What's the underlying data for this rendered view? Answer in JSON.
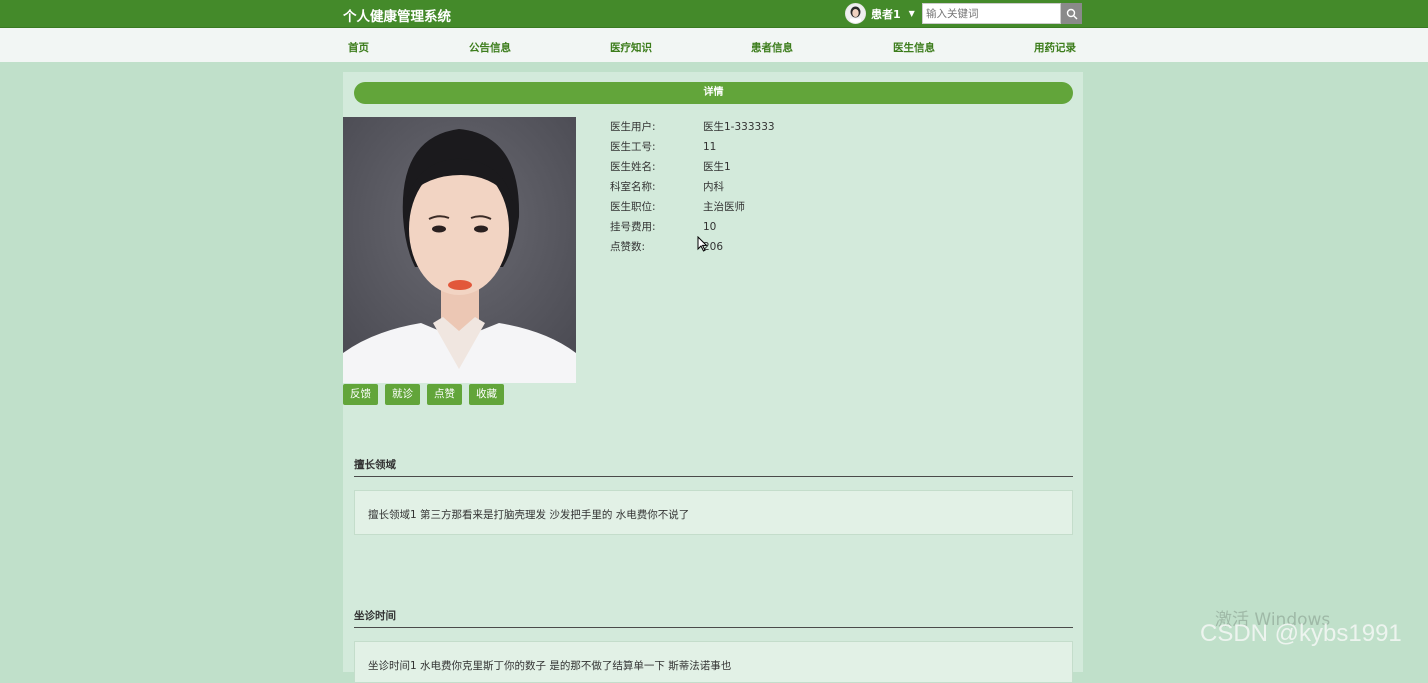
{
  "header": {
    "site_title": "个人健康管理系统",
    "user_name": "患者1",
    "search_placeholder": "输入关键词",
    "search_icon": "search-icon"
  },
  "nav": [
    {
      "label": "首页"
    },
    {
      "label": "公告信息"
    },
    {
      "label": "医疗知识"
    },
    {
      "label": "患者信息"
    },
    {
      "label": "医生信息"
    },
    {
      "label": "用药记录"
    }
  ],
  "detail": {
    "bar_label": "详情",
    "buttons": [
      "反馈",
      "就诊",
      "点赞",
      "收藏"
    ],
    "fields": [
      {
        "label": "医生用户:",
        "value": "医生1-333333"
      },
      {
        "label": "医生工号:",
        "value": "11"
      },
      {
        "label": "医生姓名:",
        "value": "医生1"
      },
      {
        "label": "科室名称:",
        "value": "内科"
      },
      {
        "label": "医生职位:",
        "value": "主治医师"
      },
      {
        "label": "挂号费用:",
        "value": "10"
      },
      {
        "label": "点赞数:",
        "value": "206"
      }
    ]
  },
  "sections": [
    {
      "title": "擅长领域",
      "text": "擅长领域1 第三方那看来是打脑壳理发 沙发把手里的 水电费你不说了"
    },
    {
      "title": "坐诊时间",
      "text": "坐诊时间1 水电费你克里斯丁你的数子 是的那不做了结算单一下 斯蒂法诺事也"
    }
  ],
  "overlay": {
    "watermark": "激活 Windows",
    "csdn": "CSDN @kybs1991"
  },
  "colors": {
    "header_green": "#448a2a",
    "accent_green": "#62a53a",
    "page_bg": "#c0e0ca"
  }
}
